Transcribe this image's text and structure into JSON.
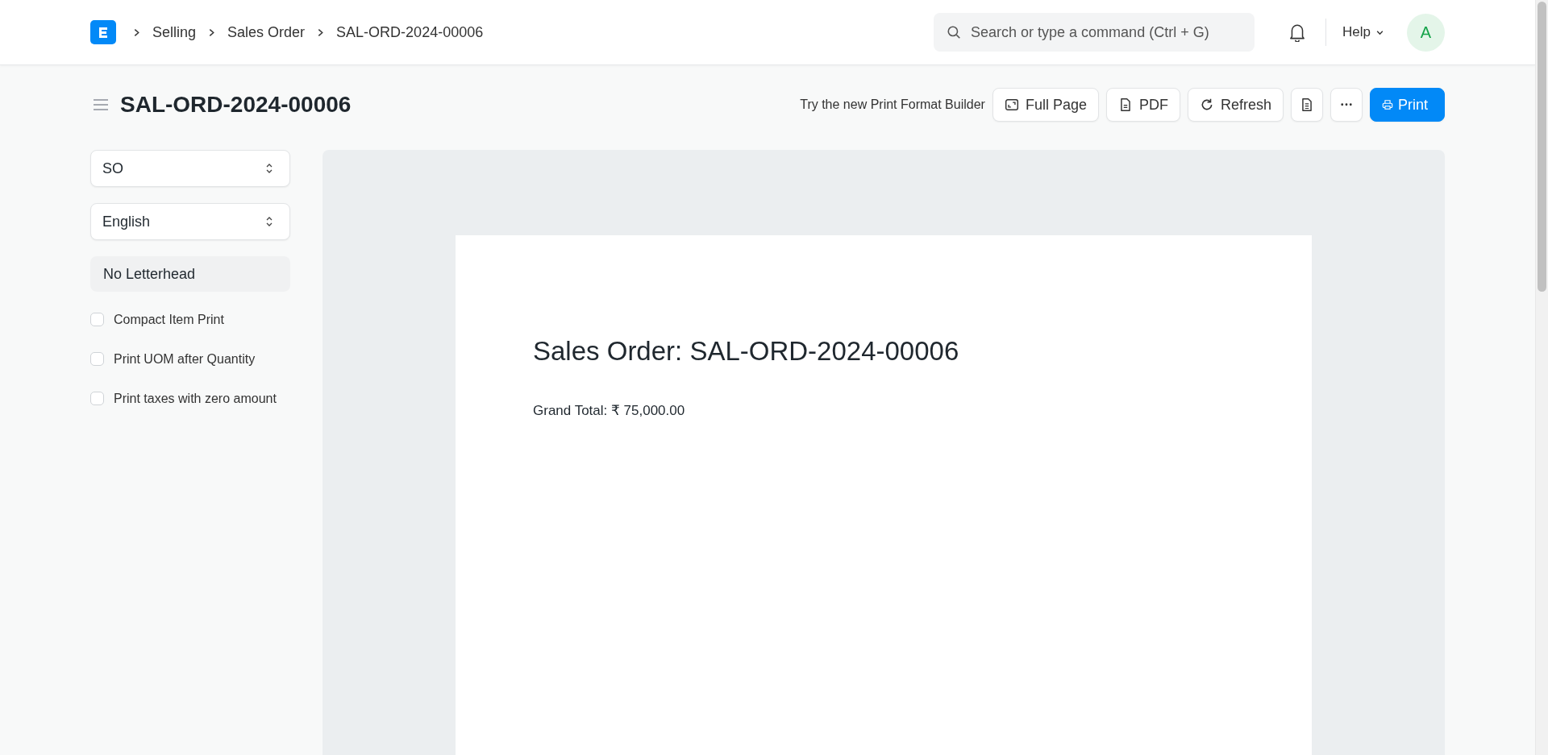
{
  "navbar": {
    "breadcrumbs": [
      "Selling",
      "Sales Order",
      "SAL-ORD-2024-00006"
    ],
    "search": {
      "placeholder": "Search or type a command (Ctrl + G)"
    },
    "help": "Help",
    "avatar": "A"
  },
  "page": {
    "title": "SAL-ORD-2024-00006"
  },
  "toolbar": {
    "hint": "Try the new Print Format Builder",
    "buttons": [
      {
        "kind": "full-page",
        "label": "Full Page"
      },
      {
        "kind": "pdf",
        "label": "PDF"
      },
      {
        "kind": "refresh",
        "label": "Refresh"
      },
      {
        "kind": "document"
      },
      {
        "kind": "more"
      },
      {
        "kind": "print",
        "label": "Print"
      }
    ]
  },
  "sidebar": {
    "selects": [
      "SO",
      "English"
    ],
    "letterhead": "No Letterhead",
    "options": [
      {
        "label": "Compact Item Print",
        "checked": false
      },
      {
        "label": "Print UOM after Quantity",
        "checked": false
      },
      {
        "label": "Print taxes with zero amount",
        "checked": false
      }
    ]
  },
  "preview": {
    "heading": "Sales Order: SAL-ORD-2024-00006",
    "total": "Grand Total: ₹ 75,000.00"
  }
}
